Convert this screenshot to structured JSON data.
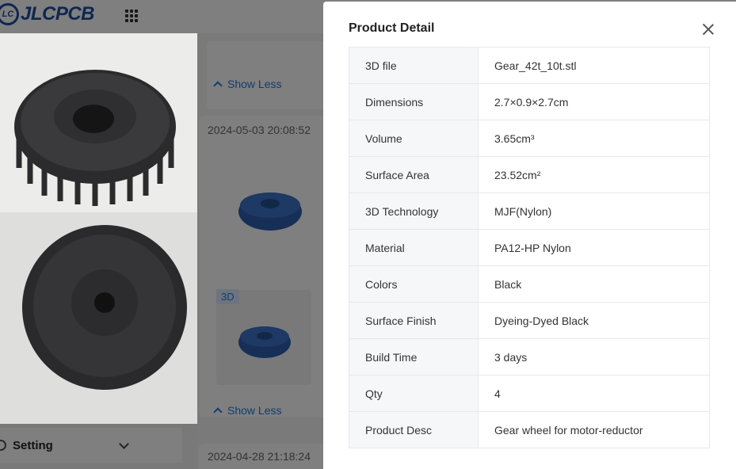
{
  "header": {
    "logo_mark": "LC",
    "logo_text": "JLCPCB",
    "apps_icon": "apps-grid-icon"
  },
  "sidebar": {
    "setting_label": "Setting"
  },
  "orders": {
    "show_less_label": "Show Less",
    "order_1_date": "2024-05-03 20:08:52",
    "order_1_badge": "3D",
    "order_2_date": "2024-04-28 21:18:24"
  },
  "modal": {
    "title": "Product Detail",
    "rows": [
      {
        "label": "3D file",
        "value": "Gear_42t_10t.stl"
      },
      {
        "label": "Dimensions",
        "value": "2.7×0.9×2.7cm"
      },
      {
        "label": "Volume",
        "value": "3.65cm³"
      },
      {
        "label": "Surface Area",
        "value": "23.52cm²"
      },
      {
        "label": "3D Technology",
        "value": "MJF(Nylon)"
      },
      {
        "label": "Material",
        "value": "PA12-HP Nylon"
      },
      {
        "label": "Colors",
        "value": "Black"
      },
      {
        "label": "Surface Finish",
        "value": "Dyeing-Dyed Black"
      },
      {
        "label": "Build Time",
        "value": "3 days"
      },
      {
        "label": "Qty",
        "value": "4"
      },
      {
        "label": "Product Desc",
        "value": "Gear wheel for motor-reductor"
      }
    ]
  },
  "colors": {
    "brand": "#1d4fa3",
    "link": "#1f7ae0",
    "part_blue": "#2e63b8"
  }
}
